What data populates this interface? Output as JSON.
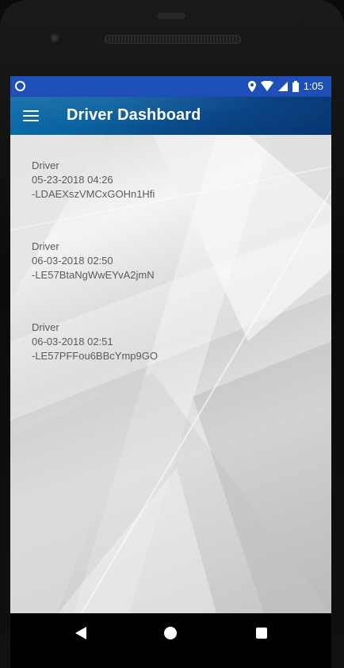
{
  "status_bar": {
    "time": "1:05",
    "icons": [
      "notification-circle-icon",
      "location-icon",
      "wifi-icon",
      "signal-icon",
      "battery-icon"
    ]
  },
  "app_bar": {
    "title": "Driver Dashboard",
    "menu_icon": "hamburger-menu-icon"
  },
  "entries": [
    {
      "label": "Driver",
      "date": "05-23-2018 04:26",
      "id": "-LDAEXszVMCxGOHn1Hfi"
    },
    {
      "label": "Driver",
      "date": "06-03-2018 02:50",
      "id": "-LE57BtaNgWwEYvA2jmN"
    },
    {
      "label": "Driver",
      "date": "06-03-2018 02:51",
      "id": "-LE57PFFou6BBcYmp9GO"
    }
  ],
  "nav_bar": {
    "back_icon": "back-triangle-icon",
    "home_icon": "home-circle-icon",
    "recent_icon": "recent-apps-square-icon"
  },
  "colors": {
    "status_bar": "#1f4fb8",
    "app_bar": "#0b5b9a",
    "text": "#5b5b5b"
  }
}
